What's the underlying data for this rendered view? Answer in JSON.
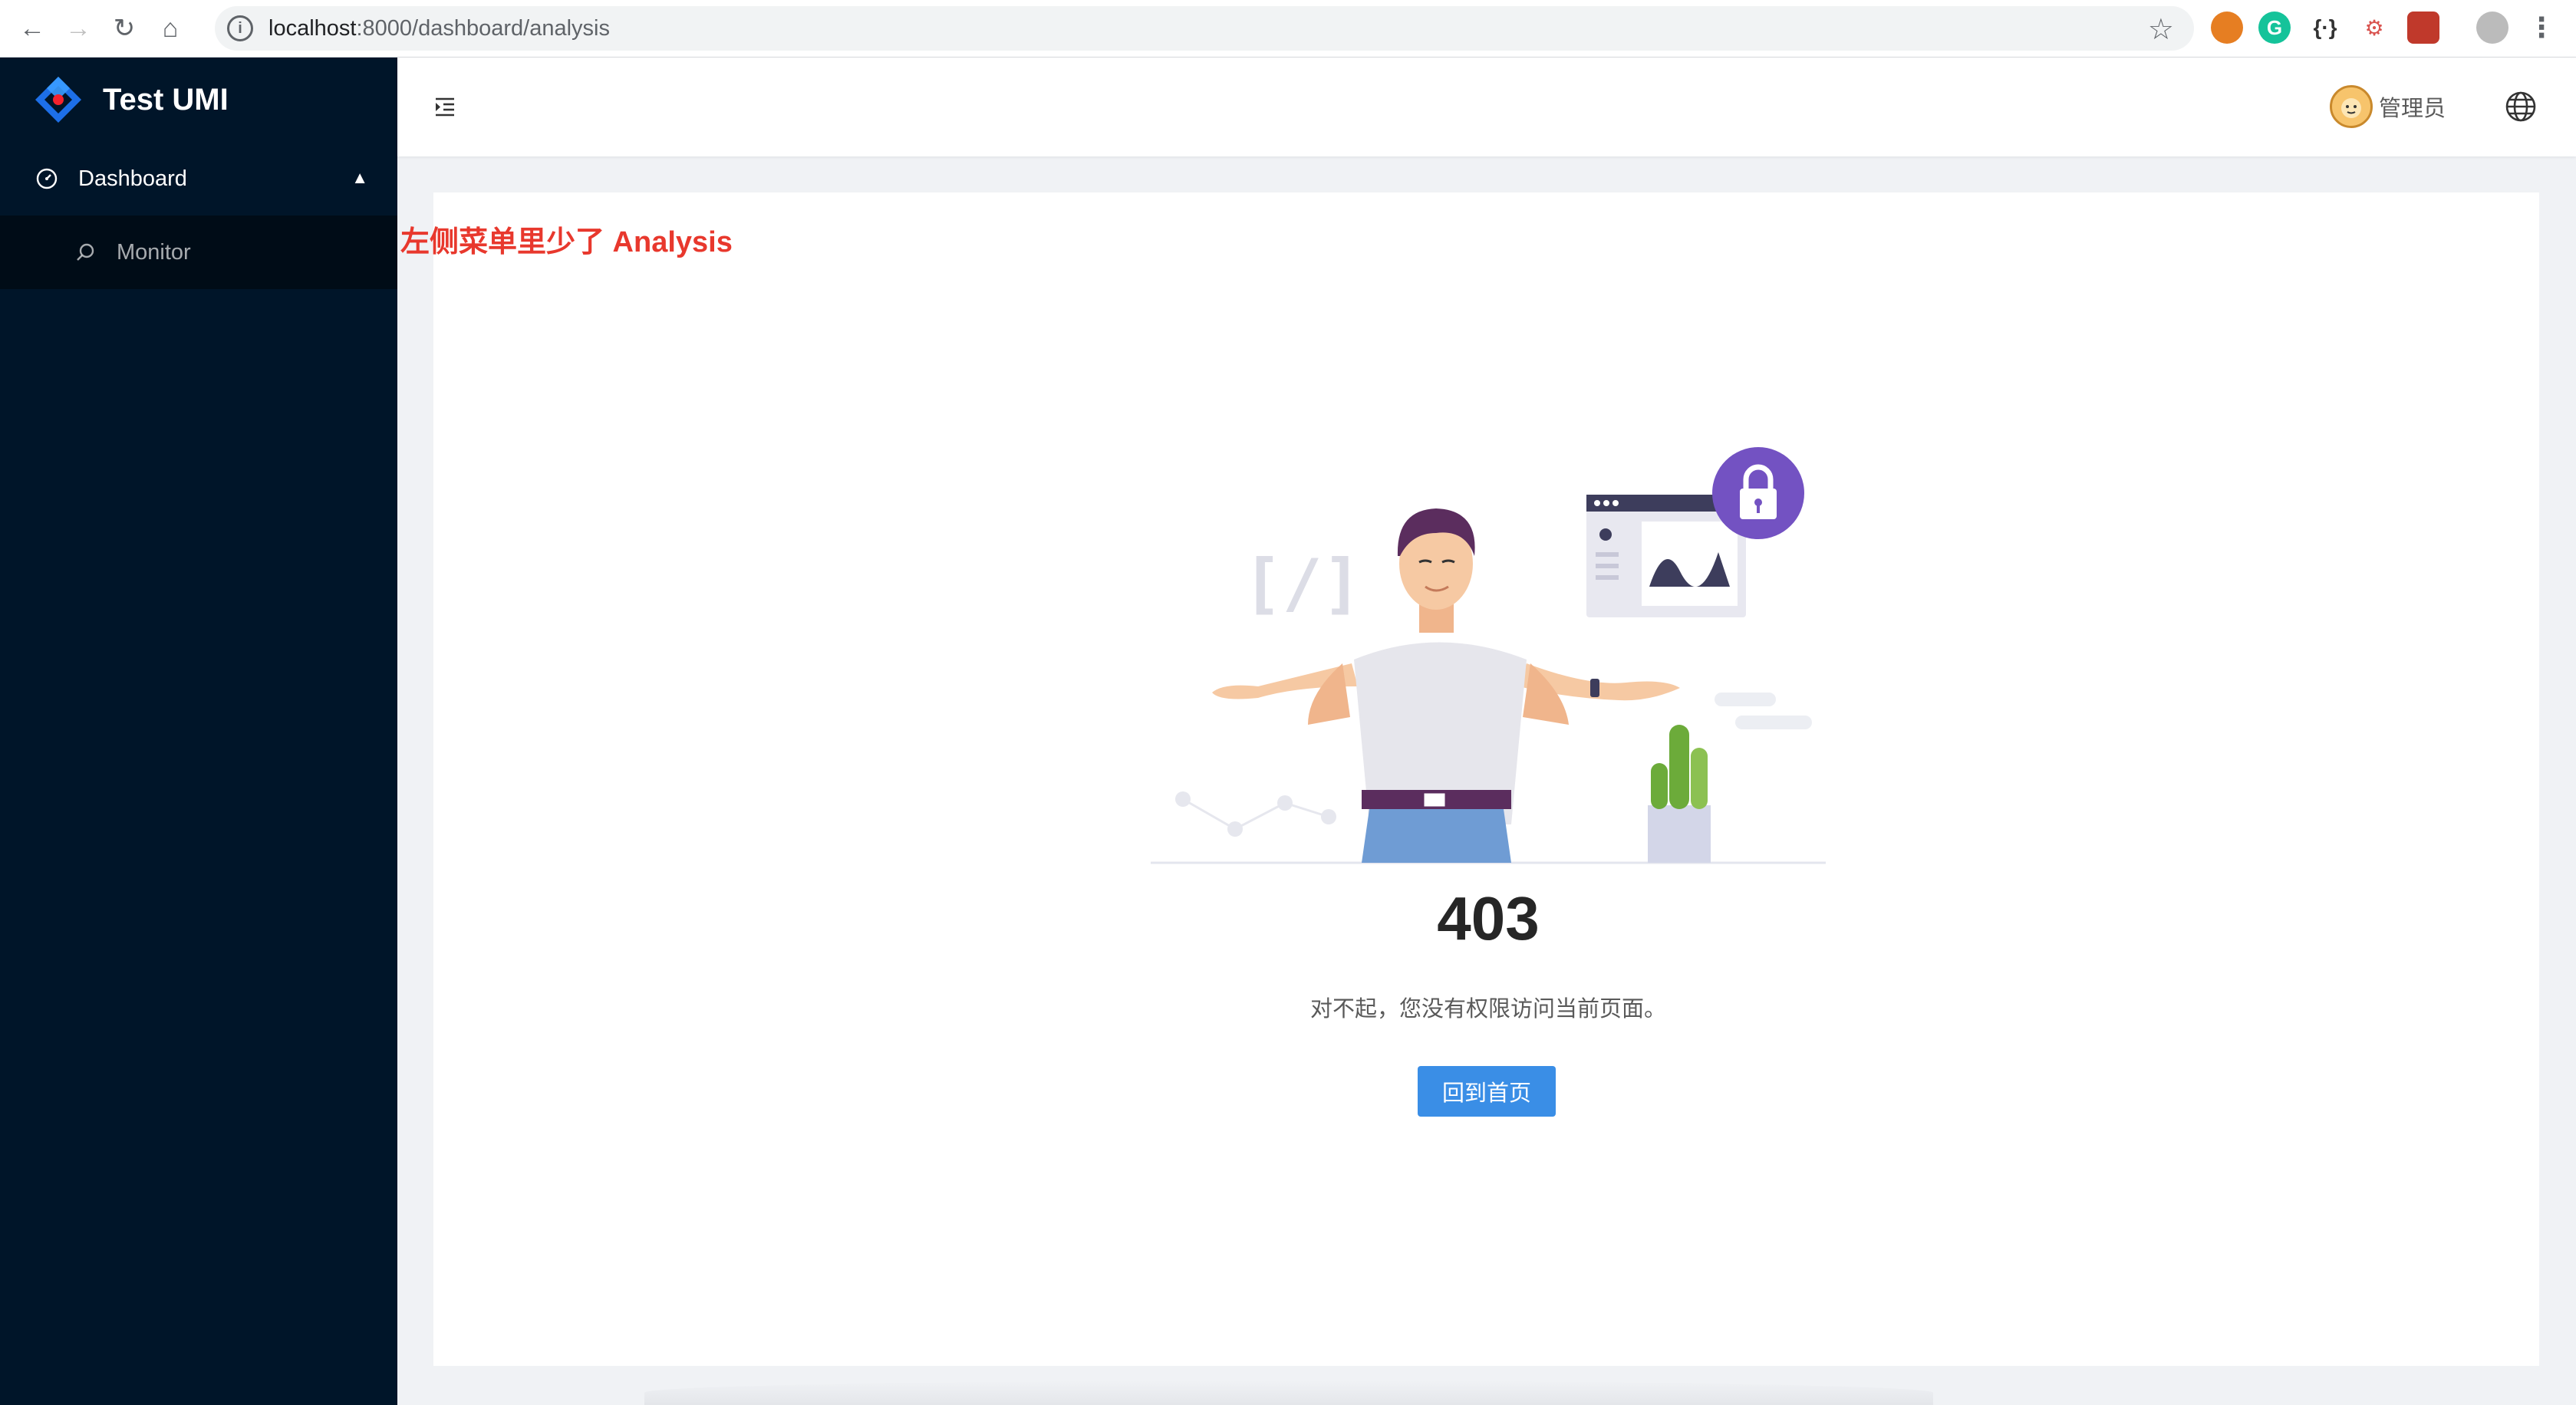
{
  "browser": {
    "url_host": "localhost",
    "url_rest": ":8000/dashboard/analysis",
    "ext_icons": [
      "robot-extension-icon",
      "grammarly-icon",
      "json-viewer-icon",
      "network-extension-icon",
      "screenshot-extension-icon",
      "profile-icon"
    ]
  },
  "sidebar": {
    "app_title": "Test UMI",
    "menu": {
      "label": "Dashboard",
      "icon": "dashboard-icon",
      "expanded": true,
      "items": [
        {
          "label": "Monitor",
          "icon": "monitor-icon"
        }
      ]
    }
  },
  "header": {
    "user_name": "管理员",
    "fold_icon": "menu-fold-icon",
    "lang_icon": "globe-icon"
  },
  "annotation": "左侧菜单里少了 Analysis",
  "result": {
    "status_code": "403",
    "message": "对不起，您没有权限访问当前页面。",
    "back_button": "回到首页"
  },
  "colors": {
    "sider_bg": "#001529",
    "primary": "#3a8ee6",
    "annotation": "#e8382d"
  }
}
